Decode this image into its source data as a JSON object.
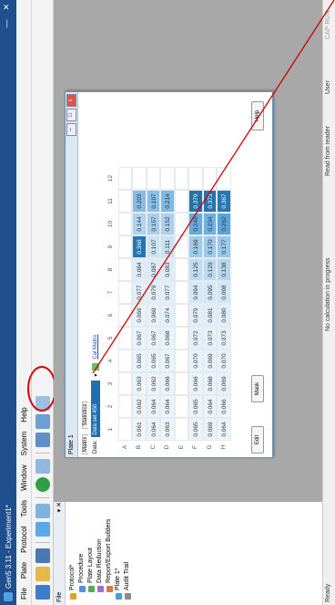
{
  "window": {
    "title": "Gen5 3.11 - Experiment1*",
    "minimize": "—",
    "close": "✕"
  },
  "menu": [
    "File",
    "Plate",
    "Protocol",
    "Tools",
    "Window",
    "System",
    "Help"
  ],
  "left_panel": {
    "title": "File",
    "tree": [
      "Protocol*",
      "Procedure",
      "Plate Layout",
      "Data Reduction",
      "Report/Export Builders",
      "Plate 1*",
      "Audit Trail"
    ]
  },
  "plate_window": {
    "title": "Plate 1",
    "tabs": [
      "Matrix",
      "Statistics"
    ],
    "data_label": "Data:",
    "data_value": "Data set 450",
    "link_text": "Cal Matrix",
    "columns": [
      "1",
      "2",
      "3",
      "4",
      "5",
      "6",
      "7",
      "8",
      "9",
      "10",
      "11",
      "12"
    ],
    "rows": [
      {
        "label": "A",
        "values": [
          "",
          "",
          "",
          "",
          "",
          "",
          "",
          "",
          "",
          "",
          "",
          ""
        ]
      },
      {
        "label": "B",
        "values": [
          "0.061",
          "0.062",
          "0.063",
          "0.065",
          "0.067",
          "0.069",
          "0.077",
          "0.084",
          "0.368",
          "0.144",
          "0.203",
          ""
        ]
      },
      {
        "label": "C",
        "values": [
          "0.064",
          "0.064",
          "0.062",
          "0.065",
          "0.067",
          "0.069",
          "0.079",
          "0.087",
          "0.107",
          "0.157",
          "0.197",
          ""
        ]
      },
      {
        "label": "D",
        "values": [
          "0.063",
          "0.064",
          "0.066",
          "0.067",
          "0.068",
          "0.074",
          "0.077",
          "0.083",
          "0.111",
          "0.152",
          "0.214",
          ""
        ]
      },
      {
        "label": "E",
        "values": [
          "",
          "",
          "",
          "",
          "",
          "",
          "",
          "",
          "",
          "",
          "",
          ""
        ]
      },
      {
        "label": "F",
        "values": [
          "0.065",
          "0.065",
          "0.066",
          "0.070",
          "0.072",
          "0.079",
          "0.094",
          "0.125",
          "0.169",
          "0.246",
          "0.379",
          ""
        ]
      },
      {
        "label": "G",
        "values": [
          "0.069",
          "0.064",
          "0.068",
          "0.069",
          "0.073",
          "0.081",
          "0.095",
          "0.129",
          "0.170",
          "0.234",
          "0.373",
          ""
        ]
      },
      {
        "label": "H",
        "values": [
          "0.064",
          "0.066",
          "0.069",
          "0.070",
          "0.073",
          "0.080",
          "0.098",
          "0.138",
          "0.177",
          "0.262",
          "0.367",
          ""
        ]
      }
    ],
    "buttons": {
      "edit": "Edit",
      "mask": "Mask",
      "help": "Help"
    }
  },
  "status": {
    "ready": "Ready",
    "calc": "No calculation in progress",
    "reader": "Read from reader",
    "user": "User",
    "company": "CAP RUN"
  },
  "colors": {
    "titlebar": "#1f4f8f",
    "highlight": "#d00000"
  }
}
